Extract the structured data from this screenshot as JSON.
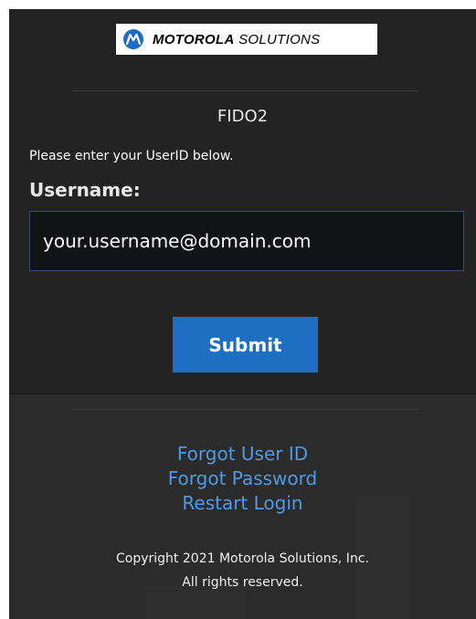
{
  "logo": {
    "brand": "MOTOROLA",
    "suffix": "SOLUTIONS",
    "icon": "motorola-m-icon",
    "accent": "#1c6bc4"
  },
  "form": {
    "title": "FIDO2",
    "instructions": "Please enter your UserID below.",
    "username_label": "Username:",
    "username_value": "your.username@domain.com",
    "submit_label": "Submit"
  },
  "links": {
    "forgot_user_id": "Forgot User ID",
    "forgot_password": "Forgot Password",
    "restart_login": "Restart Login"
  },
  "footer": {
    "copyright": "Copyright 2021 Motorola Solutions, Inc.",
    "rights": "All rights reserved."
  },
  "colors": {
    "background": "#232323",
    "button": "#1e6fc1",
    "link": "#4d9be6"
  }
}
